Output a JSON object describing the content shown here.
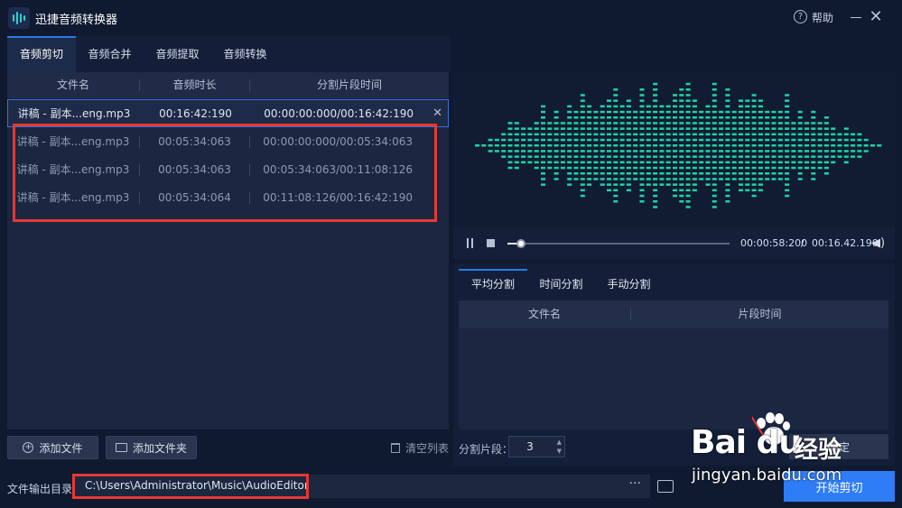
{
  "app": {
    "title": "迅捷音频转换器",
    "help": "帮助"
  },
  "tabs": [
    "音频剪切",
    "音频合并",
    "音频提取",
    "音频转换"
  ],
  "file_table": {
    "headers": [
      "文件名",
      "音频时长",
      "分割片段时间"
    ],
    "rows": [
      {
        "name": "讲稿 - 副本...eng.mp3",
        "duration": "00:16:42:190",
        "segment": "00:00:00:000/00:16:42:190"
      },
      {
        "name": "讲稿 - 副本...eng.mp3",
        "duration": "00:05:34:063",
        "segment": "00:00:00:000/00:05:34:063"
      },
      {
        "name": "讲稿 - 副本...eng.mp3",
        "duration": "00:05:34:063",
        "segment": "00:05:34:063/00:11:08:126"
      },
      {
        "name": "讲稿 - 副本...eng.mp3",
        "duration": "00:05:34:064",
        "segment": "00:11:08:126/00:16:42:190"
      }
    ]
  },
  "buttons": {
    "add_file": "添加文件",
    "add_folder": "添加文件夹",
    "clear_list": "清空列表",
    "start": "开始剪切",
    "confirm": "确定"
  },
  "output": {
    "label": "文件输出目录",
    "path": "C:\\Users\\Administrator\\Music\\AudioEditor",
    "more": "···"
  },
  "player": {
    "current_time": "00:00:58:200",
    "separator": "/",
    "total_time": "00:16.42.190",
    "progress": 0.061
  },
  "split": {
    "tabs": [
      "平均分割",
      "时间分割",
      "手动分割"
    ],
    "headers": [
      "文件名",
      "片段时间"
    ],
    "segments_label": "分割片段：",
    "segments_value": "3"
  },
  "colors": {
    "accent": "#2f7df6",
    "wave": "#1fd3a6",
    "highlight": "#e53935"
  },
  "watermark": {
    "logo": "Bai du",
    "text": "经验",
    "url": "jingyan.baidu.com"
  }
}
